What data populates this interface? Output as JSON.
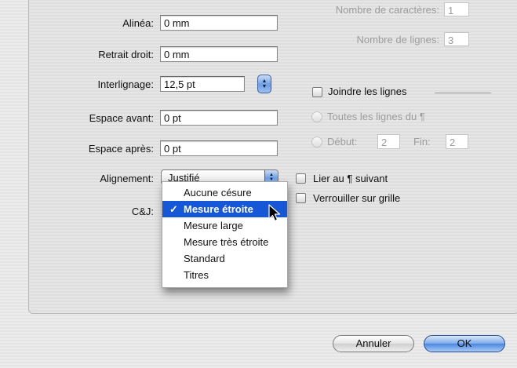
{
  "form": {
    "alinea": {
      "label": "Alinéa:",
      "value": "0 mm"
    },
    "retrait_droit": {
      "label": "Retrait droit:",
      "value": "0 mm"
    },
    "interlignage": {
      "label": "Interlignage:",
      "value": "12,5 pt"
    },
    "espace_avant": {
      "label": "Espace avant:",
      "value": "0 pt"
    },
    "espace_apres": {
      "label": "Espace après:",
      "value": "0 pt"
    },
    "alignement": {
      "label": "Alignement:",
      "value": "Justifié"
    },
    "cj": {
      "label": "C&J:"
    }
  },
  "right": {
    "nb_caracteres": {
      "label": "Nombre de caractères:",
      "value": "1"
    },
    "nb_lignes": {
      "label": "Nombre de lignes:",
      "value": "3"
    },
    "joindre": {
      "label": "Joindre les lignes",
      "checked": false
    },
    "toutes": {
      "label": "Toutes les lignes du ¶"
    },
    "debut": {
      "label": "Début:",
      "value": "2"
    },
    "fin": {
      "label": "Fin:",
      "value": "2"
    },
    "lier": {
      "label": "Lier au ¶ suivant",
      "checked": false
    },
    "verrouiller": {
      "label": "Verrouiller sur grille",
      "checked": false
    }
  },
  "menu": {
    "items": [
      "Aucune césure",
      "Mesure étroite",
      "Mesure large",
      "Mesure très étroite",
      "Standard",
      "Titres"
    ],
    "selected_index": 1,
    "check_mark": "✓"
  },
  "buttons": {
    "cancel": "Annuler",
    "ok": "OK"
  },
  "colors": {
    "selection": "#1557d6",
    "ok_button": "#4a86e0"
  }
}
